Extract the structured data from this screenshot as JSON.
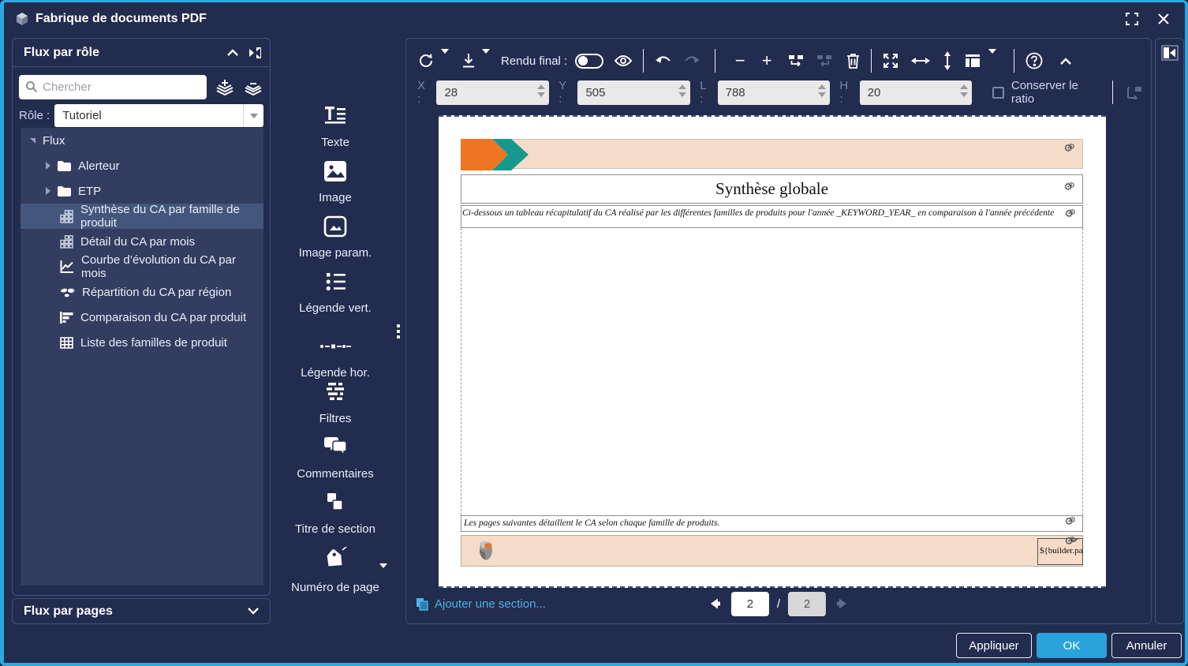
{
  "window": {
    "title": "Fabrique de documents PDF"
  },
  "sidebar": {
    "panel_title": "Flux par rôle",
    "search_placeholder": "Chercher",
    "role_label": "Rôle :",
    "role_value": "Tutoriel",
    "tree": {
      "items": [
        {
          "label": "Flux",
          "icon": "tree-expander",
          "level": 0
        },
        {
          "label": "Alerteur",
          "icon": "folder-icon",
          "level": 1
        },
        {
          "label": "ETP",
          "icon": "folder-icon",
          "level": 1
        },
        {
          "label": "Synthèse du CA par famille de produit",
          "icon": "grid-icon",
          "level": 2,
          "selected": true
        },
        {
          "label": "Détail du CA par mois",
          "icon": "grid-icon",
          "level": 2
        },
        {
          "label": "Courbe d’évolution du CA par mois",
          "icon": "line-chart-icon",
          "level": 2
        },
        {
          "label": "Répartition du CA par région",
          "icon": "map-icon",
          "level": 2
        },
        {
          "label": "Comparaison du CA par produit",
          "icon": "bars-icon",
          "level": 2
        },
        {
          "label": "Liste des familles de produit",
          "icon": "table-icon",
          "level": 2
        }
      ]
    },
    "pages_panel_title": "Flux par pages"
  },
  "palette": {
    "items": [
      {
        "label": "Texte"
      },
      {
        "label": "Image"
      },
      {
        "label": "Image param."
      },
      {
        "label": "Légende vert."
      },
      {
        "label": "Légende hor."
      },
      {
        "label": "Filtres"
      },
      {
        "label": "Commentaires"
      },
      {
        "label": "Titre de section"
      },
      {
        "label": "Numéro de page"
      }
    ]
  },
  "toolbar": {
    "rendu_label": "Rendu final :"
  },
  "coords": {
    "x_label": "X :",
    "x": "28",
    "y_label": "Y :",
    "y": "505",
    "l_label": "L :",
    "l": "788",
    "h_label": "H :",
    "h": "20",
    "ratio_label": "Conserver le ratio"
  },
  "document": {
    "title": "Synthèse globale",
    "intro": "Ci-dessous un tableau récapitulatif du CA réalisé par les différentes familles de produits pour l'année _KEYWORD_YEAR_ en comparaison à l'année précédente",
    "outro": "Les pages suivantes détaillent le CA selon chaque famille de produits.",
    "footer_variable": "${builder.pa"
  },
  "bottom_bar": {
    "add_section_label": "Ajouter une section...",
    "page_current": "2",
    "page_separator": "/",
    "page_total": "2"
  },
  "footer_buttons": {
    "apply": "Appliquer",
    "ok": "OK",
    "cancel": "Annuler"
  },
  "colors": {
    "accent": "#2aa9e0",
    "ok_button": "#2ba2da",
    "band_peach": "#f5dcc9",
    "arrow_orange": "#ee7623",
    "arrow_teal": "#17988f",
    "link_blue": "#4db3e6"
  }
}
